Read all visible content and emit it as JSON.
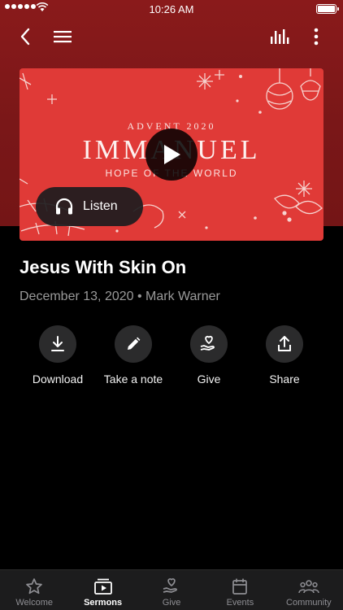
{
  "status_bar": {
    "time": "10:26 AM"
  },
  "nav": {
    "back_icon": "chevron-left-icon",
    "menu_icon": "hamburger-icon",
    "audio_icon": "equalizer-icon",
    "more_icon": "more-vertical-icon"
  },
  "artwork": {
    "line1": "ADVENT 2020",
    "line2": "IMMANUEL",
    "line3": "HOPE OF THE WORLD",
    "background_color": "#e03a37"
  },
  "listen_button": {
    "label": "Listen",
    "icon": "headphones-icon"
  },
  "sermon": {
    "title": "Jesus With Skin On",
    "meta": "December 13, 2020 • Mark Warner"
  },
  "actions": [
    {
      "label": "Download",
      "icon": "download-icon"
    },
    {
      "label": "Take a note",
      "icon": "pencil-icon"
    },
    {
      "label": "Give",
      "icon": "heart-hand-icon"
    },
    {
      "label": "Share",
      "icon": "share-icon"
    }
  ],
  "tabs": [
    {
      "label": "Welcome",
      "icon": "star-icon",
      "active": false
    },
    {
      "label": "Sermons",
      "icon": "play-stack-icon",
      "active": true
    },
    {
      "label": "Give",
      "icon": "heart-hand-icon",
      "active": false
    },
    {
      "label": "Events",
      "icon": "calendar-icon",
      "active": false
    },
    {
      "label": "Community",
      "icon": "group-icon",
      "active": false
    }
  ],
  "colors": {
    "header_red": "#7a1718",
    "tab_bar": "#1c1c1d",
    "action_circle": "#2b2b2c",
    "meta_gray": "#9a9a9a"
  }
}
